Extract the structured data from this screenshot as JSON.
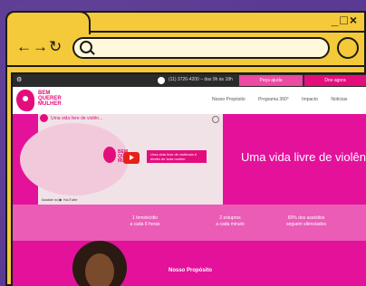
{
  "window": {
    "controls": "_□×",
    "nav": "←→↻"
  },
  "site": {
    "brand": "BEM QUERER MULHER",
    "topbar": {
      "phone": "(11) 3726-4200 – das 9h às 18h",
      "help_label": "Peça ajuda",
      "donate_label": "Doe agora"
    },
    "menu": [
      "Nosso Propósito",
      "Programa 360°",
      "Impacto",
      "Notícias"
    ],
    "video": {
      "title": "Uma vida livre de violên...",
      "brand": "BEM QUERER MULHER",
      "tag": "Uma vida livre de violência é direito de toda mulher",
      "watch": "Assistir no ▶ YouTube"
    },
    "hero_title": "Uma vida livre de violên",
    "stats": [
      {
        "line1": "1 feminicídio",
        "line2": "a cada 6 horas"
      },
      {
        "line1": "2 estupros",
        "line2": "a cada minuto"
      },
      {
        "line1": "60% dos assédios",
        "line2": "seguem silenciados"
      }
    ],
    "section_title": "Nosso Propósito"
  }
}
